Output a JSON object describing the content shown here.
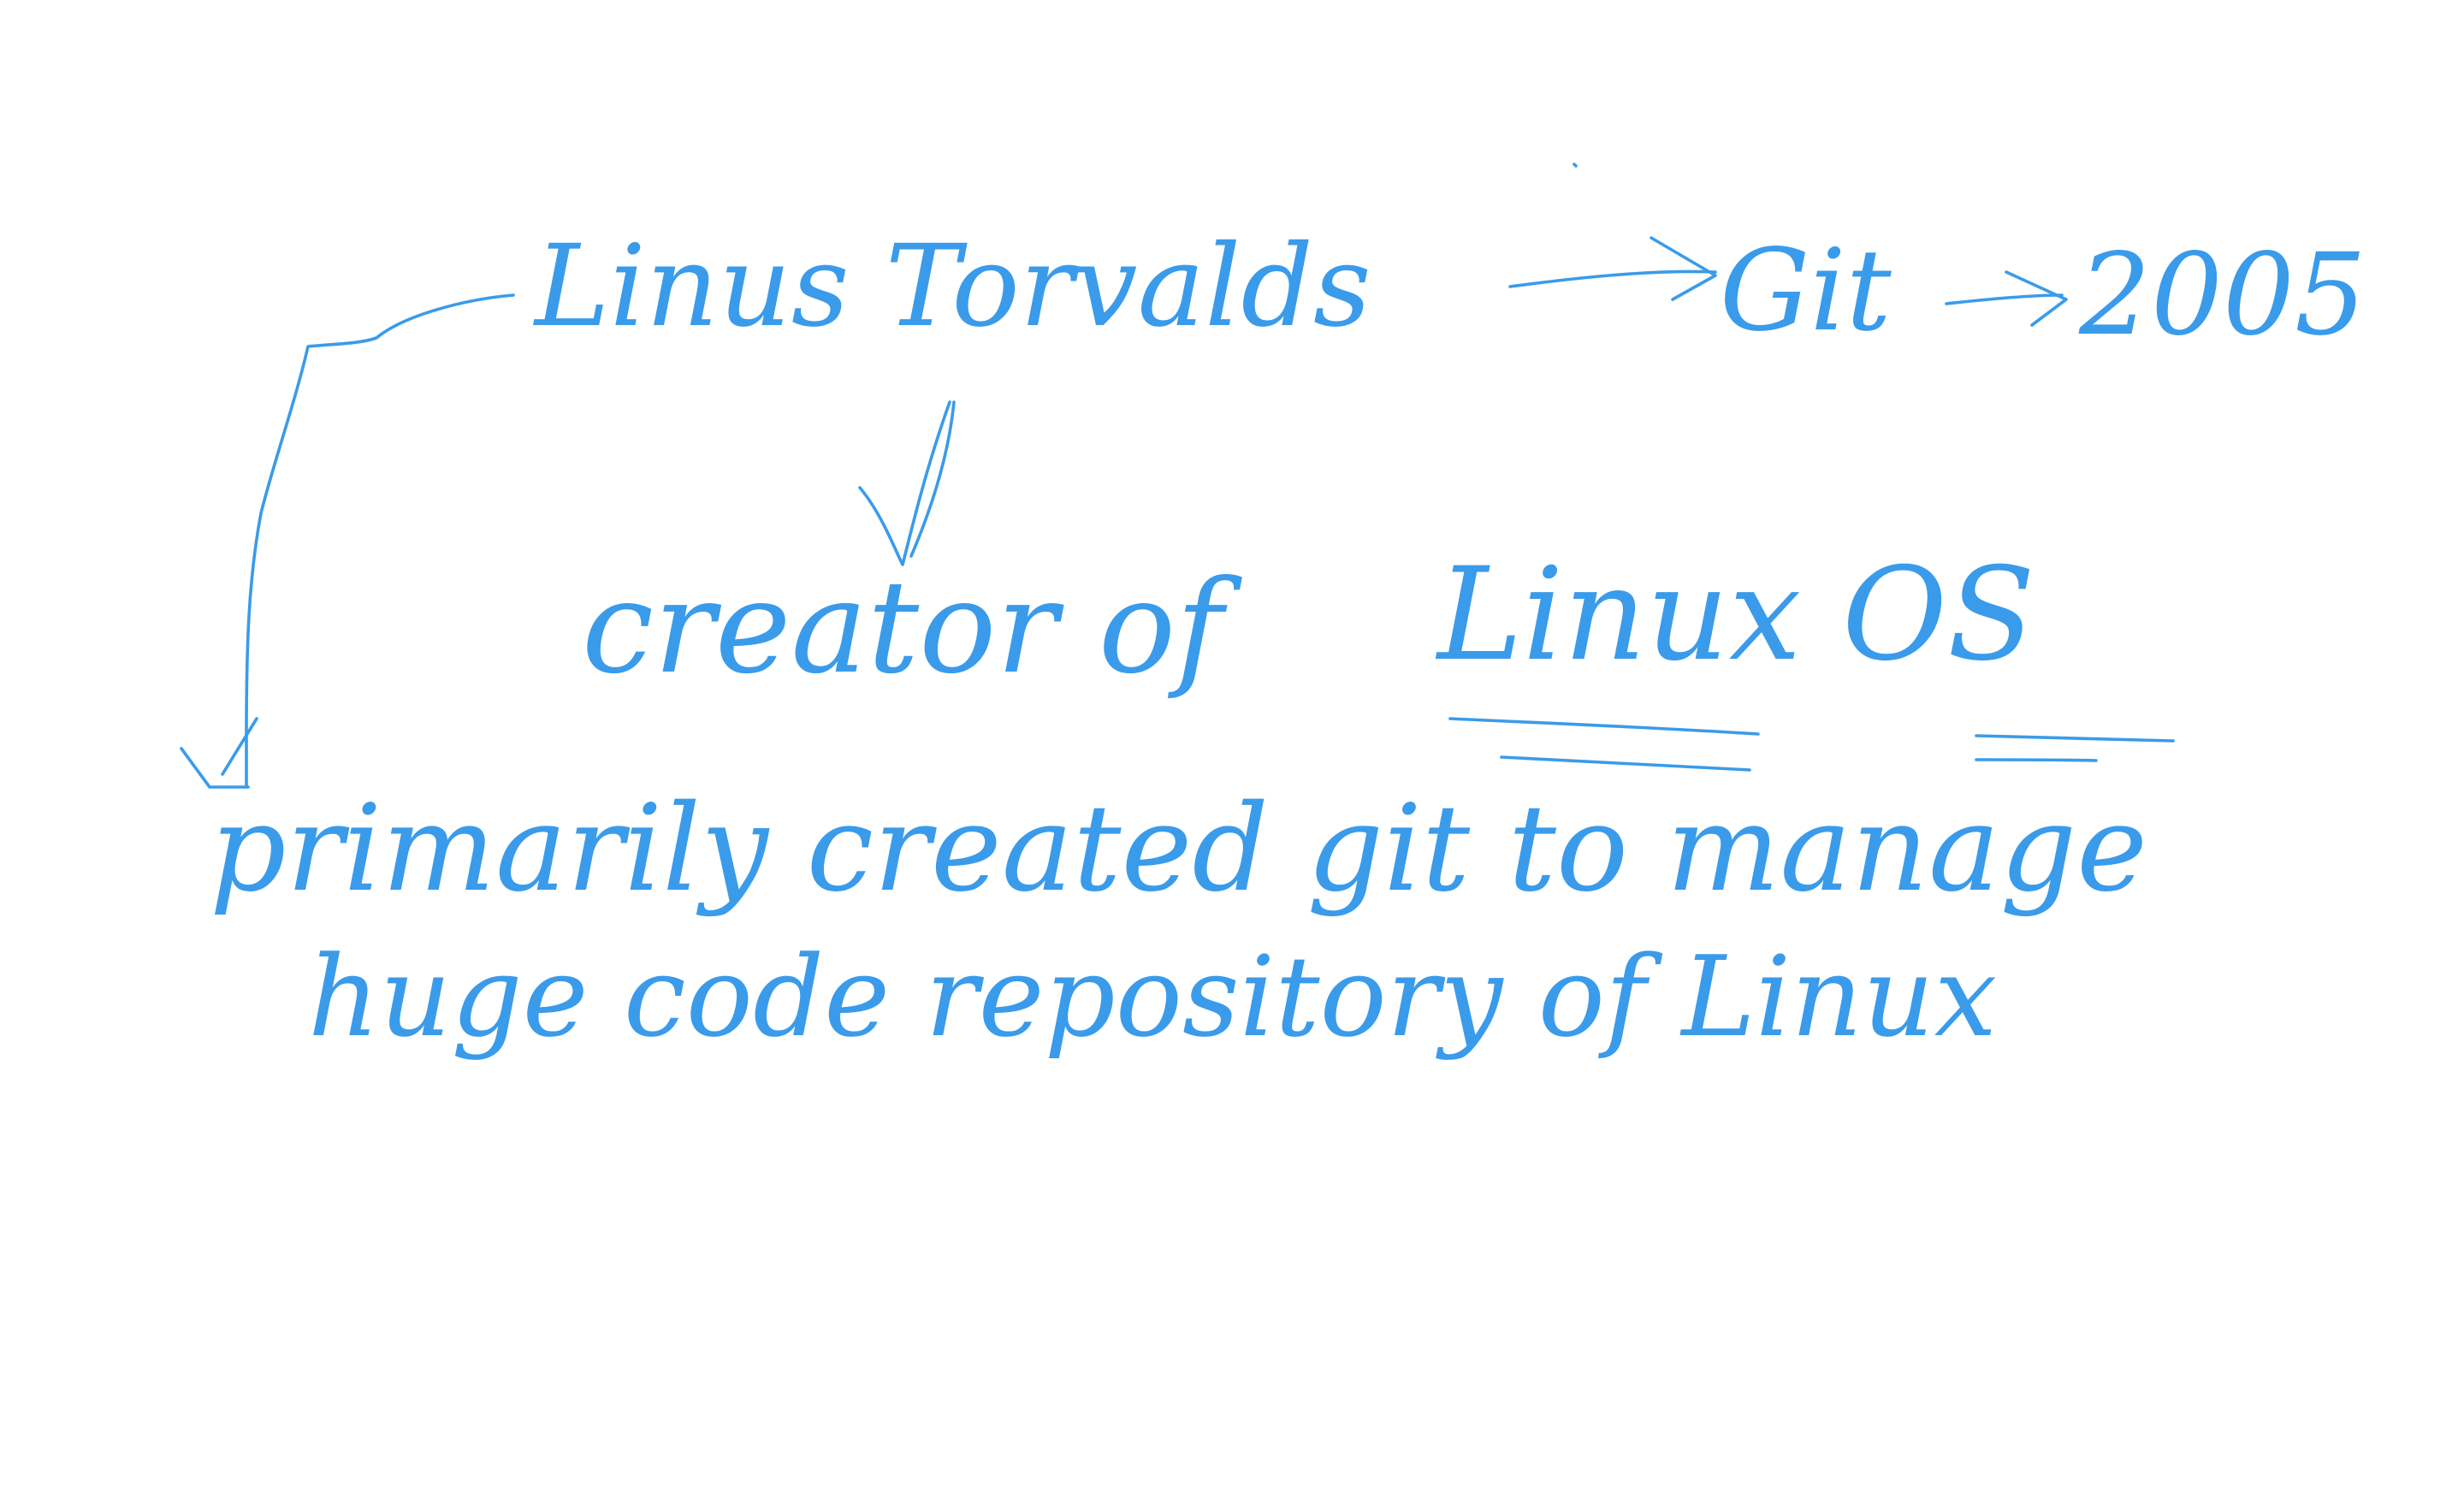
{
  "ink_color": "#3a9bea",
  "background_color": "#ffffff",
  "note_lines": {
    "line1_name": "Linus Torvalds",
    "line1_tool": "Git",
    "line1_year": "2005",
    "line2_role": "creator of",
    "line2_os": "Linux OS",
    "line3": "primarily created git to manage",
    "line4": "huge code repository of Linux"
  }
}
